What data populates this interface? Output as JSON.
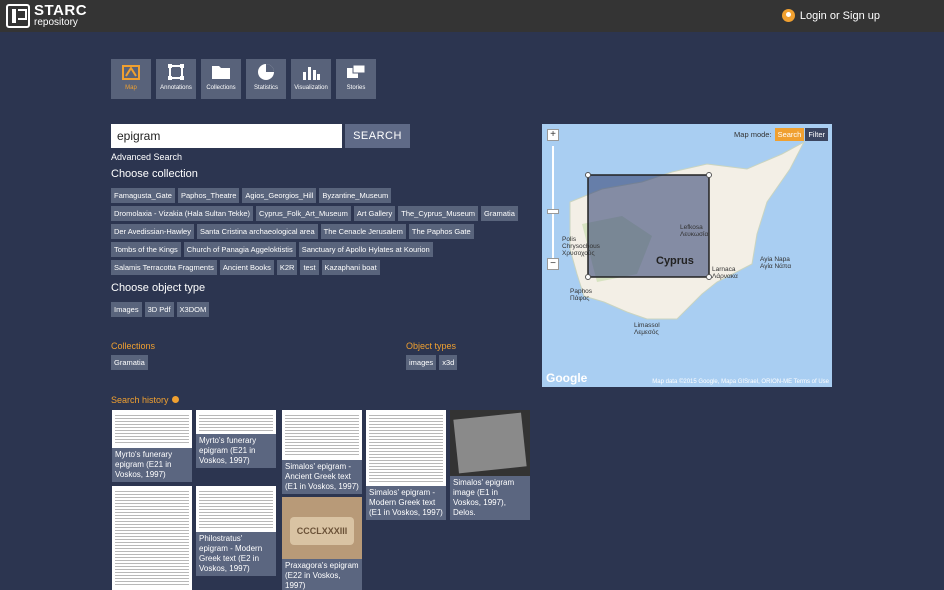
{
  "header": {
    "logo_title": "STARC",
    "logo_sub": "repository",
    "login_label": "Login or Sign up"
  },
  "toolbar": [
    {
      "label": "Map",
      "icon": "map-icon",
      "active": true
    },
    {
      "label": "Annotations",
      "icon": "annotation-icon"
    },
    {
      "label": "Collections",
      "icon": "folder-icon"
    },
    {
      "label": "Statistics",
      "icon": "pie-chart-icon"
    },
    {
      "label": "Visualization",
      "icon": "bar-chart-icon"
    },
    {
      "label": "Stories",
      "icon": "stories-icon"
    }
  ],
  "search": {
    "value": "epigram",
    "button": "SEARCH",
    "advanced": "Advanced Search"
  },
  "collections_heading": "Choose collection",
  "collections": [
    "Famagusta_Gate",
    "Paphos_Theatre",
    "Agios_Georgios_Hill",
    "Byzantine_Museum",
    "Dromolaxia - Vizakia (Hala Sultan Tekke)",
    "Cyprus_Folk_Art_Museum",
    "Art Gallery",
    "The_Cyprus_Museum",
    "Gramatia",
    "Der Avedissian-Hawley",
    "Santa Cristina archaeological area",
    "The Cenacle Jerusalem",
    "The Paphos Gate",
    "Tombs of the Kings",
    "Church of Panagia Aggeloktistis",
    "Sanctuary of Apollo Hylates at Kourion",
    "Salamis Terracotta Fragments",
    "Ancient Books",
    "K2R",
    "test",
    "Kazaphani boat"
  ],
  "object_type_heading": "Choose object type",
  "object_types": [
    "Images",
    "3D Pdf",
    "X3DOM"
  ],
  "filters": {
    "collections_label": "Collections",
    "collections_selected": "Gramatia",
    "types_label": "Object types",
    "types_selected": [
      "images",
      "x3d"
    ]
  },
  "history_label": "Search history",
  "results": [
    {
      "caption": "Myrto's funerary epigram (E21 in Voskos, 1997)"
    },
    {
      "caption": "Myrto's funerary epigram (E21 in Voskos, 1997)"
    },
    {
      "caption": "Simalos' epigram - Ancient Greek text (E1 in Voskos, 1997)"
    },
    {
      "caption": "Simalos' epigram - Modern Greek text (E1 in Voskos, 1997)"
    },
    {
      "caption": "Simalos' epigram image (E1 in Voskos, 1997), Delos."
    },
    {
      "caption": "Philostratus' epigram - Modern Greek text (E2 in Voskos, 1997)"
    },
    {
      "caption": "Praxagora's epigram (E22 in Voskos, 1997)",
      "stone_text": "CCCLXXXIII"
    }
  ],
  "map": {
    "mode_label": "Map mode:",
    "mode_search": "Search",
    "mode_filter": "Filter",
    "zoom_in": "+",
    "zoom_out": "−",
    "place_cyprus": "Cyprus",
    "place_lefkosia": "Lefkosa\nΛευκωσία",
    "place_paphos": "Paphos\nΠάφος",
    "place_limassol": "Limassol\nΛεμεσός",
    "place_larnaca": "Larnaca\nΛάρνακα",
    "place_polis": "Polis\nChrysochous\nΧρυσοχούς",
    "place_ayianapa": "Ayia Napa\nΑγία Νάπα",
    "google": "Google",
    "attribution": "Map data ©2015 Google, Mapa GISrael, ORION-ME    Terms of Use",
    "colors": {
      "sea": "#a9cef2",
      "land": "#f3efe6",
      "selection": "#3b4a78"
    }
  }
}
